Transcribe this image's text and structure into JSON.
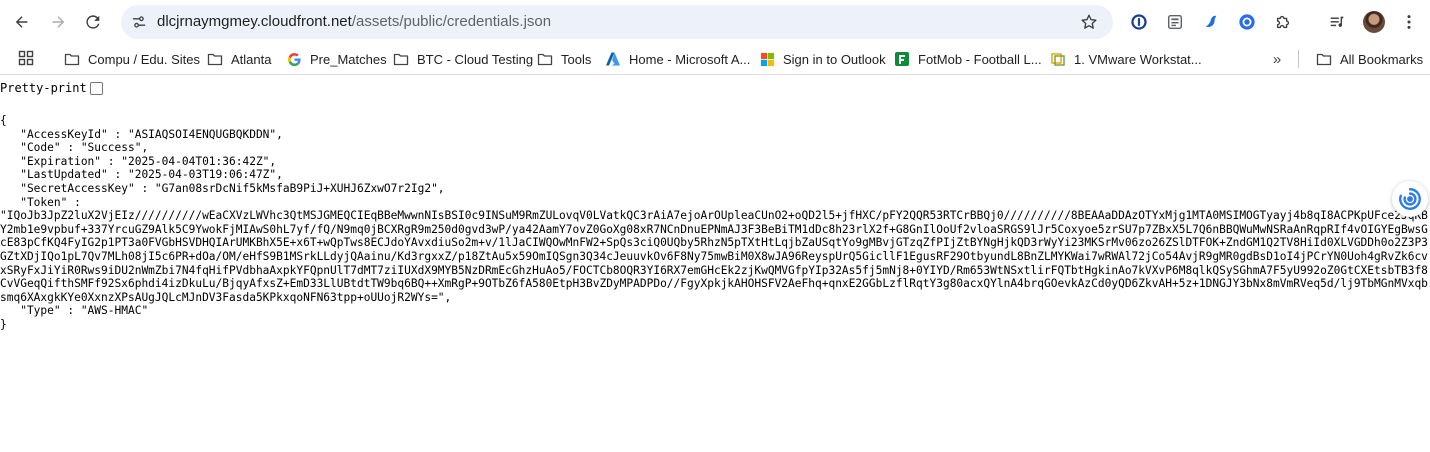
{
  "browser": {
    "url_host": "dlcjrnaymgmey.cloudfront.net",
    "url_path": "/assets/public/credentials.json"
  },
  "bookmarks": [
    {
      "label": "Compu / Edu. Sites",
      "icon": "folder-icon"
    },
    {
      "label": "Atlanta",
      "icon": "folder-icon"
    },
    {
      "label": "Pre_Matches",
      "icon": "google-icon"
    },
    {
      "label": "BTC - Cloud Testing",
      "icon": "folder-icon"
    },
    {
      "label": "Tools",
      "icon": "folder-icon"
    },
    {
      "label": "Home - Microsoft A...",
      "icon": "azure-icon"
    },
    {
      "label": "Sign in to Outlook",
      "icon": "microsoft-icon"
    },
    {
      "label": "FotMob - Football L...",
      "icon": "fotmob-icon"
    },
    {
      "label": "1. VMware Workstat...",
      "icon": "vmware-icon"
    },
    {
      "label": "All Bookmarks",
      "icon": "folder-icon"
    }
  ],
  "page": {
    "pretty_print_label": "Pretty-print",
    "json_lines": [
      "{",
      "   \"AccessKeyId\" : \"ASIAQSOI4ENQUGBQKDDN\",",
      "   \"Code\" : \"Success\",",
      "   \"Expiration\" : \"2025-04-04T01:36:42Z\",",
      "   \"LastUpdated\" : \"2025-04-03T19:06:47Z\",",
      "   \"SecretAccessKey\" : \"G7an08srDcNif5kMsfaB9PiJ+XUHJ6ZxwO7r2Ig2\",",
      "   \"Token\" :",
      "\"IQoJb3JpZ2luX2VjEIz//////////wEaCXVzLWVhc3QtMSJGMEQCIEqBBeMwwnNIsBSI0c9INSuM9RmZULovqV0LVatkQC3rAiA7ejoArOUpleaCUnO2+oQD2l5+jfHXC/pFY2QQR53RTCrBBQj0//////////8BEAAaDDAzOTYxMjg1MTA0MSIMOGTyayj4b8qI8ACPKpUFce2JqKBY2mb1e9vpbuf+337YrcuGZ9Alk5C9YwokFjMIAwS0hL7yf/fQ/N9mq0jBCXRgR9m250d0gvd3wP/ya42AamY7ovZ0GoXg08xR7NCnDnuEPNmAJ3F3BeBiTM1dDc8h23rlX2f+G8GnIlOoUf2vloaSRGS9lJr5Coxyoe5zrSU7p7ZBxX5L7Q6nBBQWuMwNSRaAnRqpRIf4vOIGYEgBwsGcE83pCfKQ4FyIG2p1PT3a0FVGbHSVDHQIArUMKBhX5E+x6T+wQpTws8ECJdoYAvxdiuSo2m+v/1lJaCIWQOwMnFW2+SpQs3ciQ0UQby5RhzN5pTXtHtLqjbZaUSqtYo9gMBvjGTzqZfPIjZtBYNgHjkQD3rWyYi23MKSrMv06zo26ZSlDTFOK+ZndGM1Q2TV8HiId0XLVGDDh0o2Z3P3GZtXDjIQo1pL7Qv7MLh08jI5c6PR+dOa/OM/eHfS9B1MSrkLLdyjQAainu/Kd3rgxxZ/p18ZtAu5x59OmIQSgn3Q34cJeuuvkOv6F8Ny75mwBiM0X8wJA96ReyspUrQ5GicllF1EgusRF29OtbyundL8BnZLMYKWai7wRWAl72jCo54AvjR9gMR0gdBsD1oI4jPCrYN0Uoh4gRvZk6cvxSRyFxJiYiR0Rws9iDU2nWmZbi7N4fqHifPVdbhaAxpkYFQpnUlT7dMT7ziIUXdX9MYB5NzDRmEcGhzHuAo5/FOCTCb8OQR3YI6RX7emGHcEk2zjKwQMVGfpYIp32As5fj5mNj8+0YIYD/Rm653WtNSxtlirFQTbtHgkinAo7kVXvP6M8qlkQSySGhmA7F5yU992oZ0GtCXEtsbTB3f8CvVGeqQifthSMFf92Sx6phdi4izDkuLu/BjqyAfxsZ+EmD33LlUBtdtTW9bq6BQ++XmRgP+9OTbZ6fA580EtpH3BvZDyMPADPDo//FgyXpkjkAHOHSFV2AeFhq+qnxE2GGbLzflRqtY3g80acxQYlnA4brqGOevkAzCd0yQD6ZkvAH+5z+1DNGJY3bNx8mVmRVeq5d/lj9TbMGnMVxqbsmq6XAxgkKYe0XxnzXPsAUgJQLcMJnDV3Fasda5KPkxqoNFN63tpp+oUUojR2WYs=\",",
      "   \"Type\" : \"AWS-HMAC\"",
      "}"
    ]
  }
}
